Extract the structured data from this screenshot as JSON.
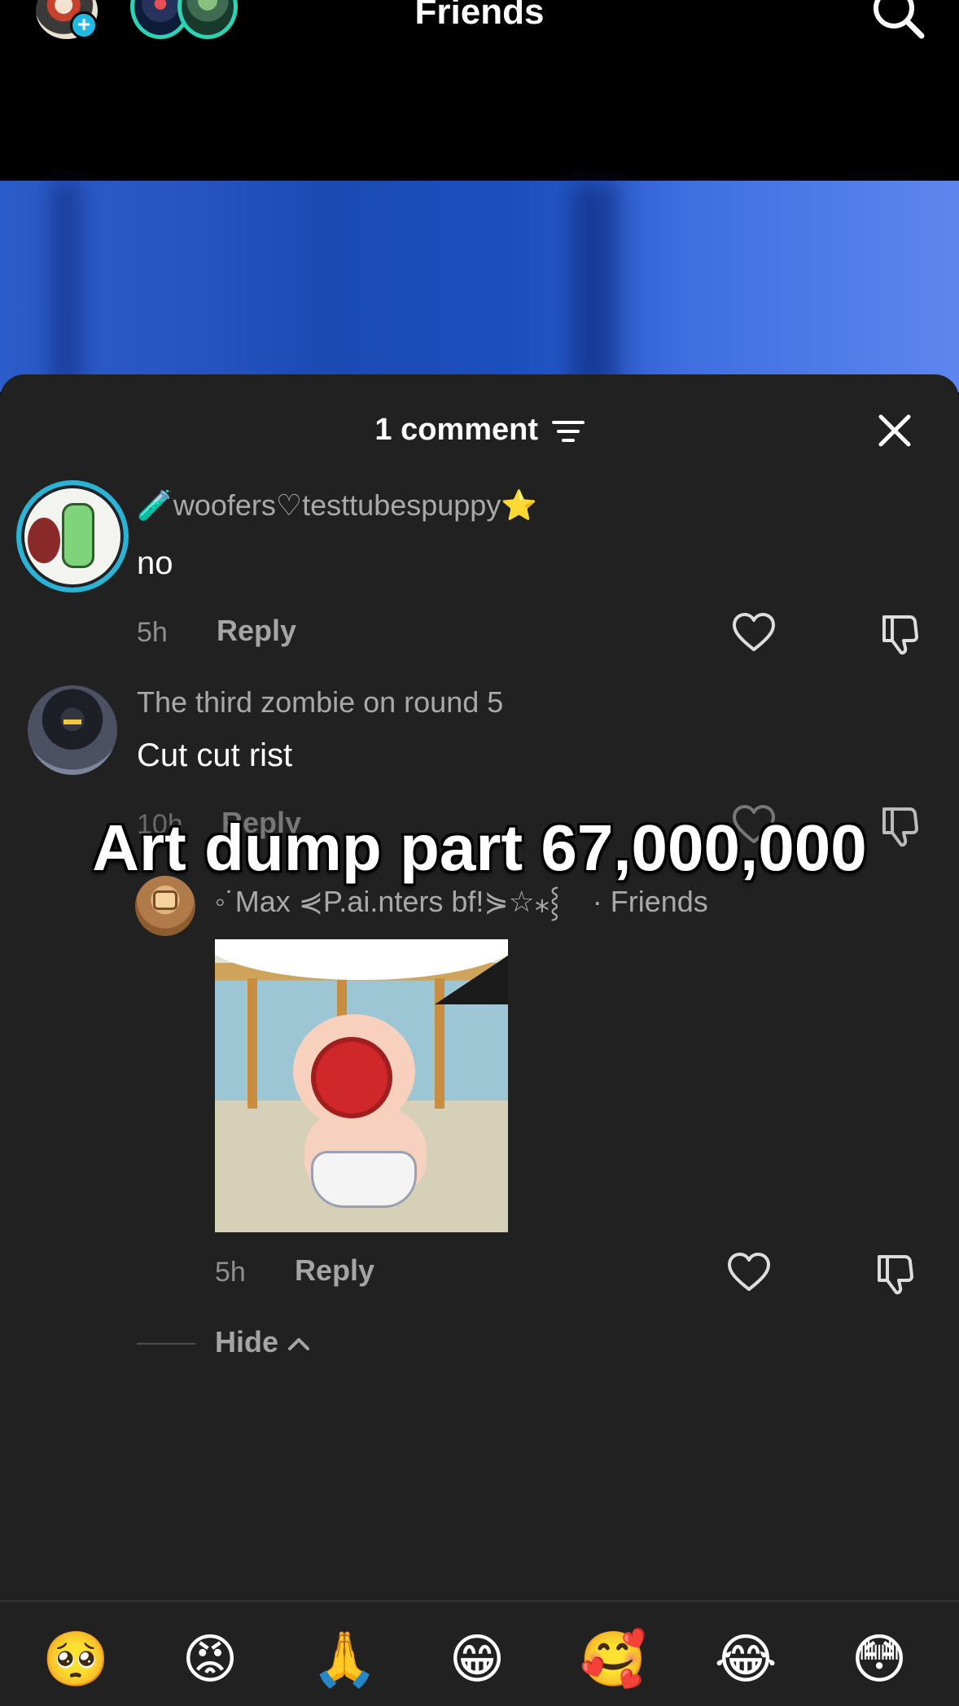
{
  "top_bar": {
    "title": "Friends",
    "icons": [
      "friend-avatar-icon",
      "plus-icon",
      "story-avatar-icon",
      "story-avatar-icon",
      "search-icon"
    ]
  },
  "comments_sheet": {
    "count_label": "1 comment",
    "icons": [
      "filter-icon",
      "close-icon"
    ],
    "comments": [
      {
        "username": "🧪woofers♡testtubespuppy⭐",
        "text": "no",
        "time": "5h",
        "reply_label": "Reply"
      },
      {
        "username": "The third zombie on round 5",
        "text": "Cut cut rist",
        "time": "10h",
        "reply_label": "Reply"
      }
    ],
    "reply": {
      "username": "◦˙Max ⋞P.ai.nters bf!⋟☆⁎⸾",
      "tag": "· Friends",
      "time": "5h",
      "reply_label": "Reply"
    },
    "hide_label": "Hide",
    "overlay_caption": "Art dump part 67,000,000"
  },
  "emoji_bar": {
    "emojis": [
      "🥺",
      "😡",
      "🙏",
      "😁",
      "🥰",
      "😂",
      "😳"
    ]
  },
  "colors": {
    "sheet_bg": "#212121",
    "avatar_ring": "#29b3d6",
    "story_ring": "#2bd4b5"
  }
}
